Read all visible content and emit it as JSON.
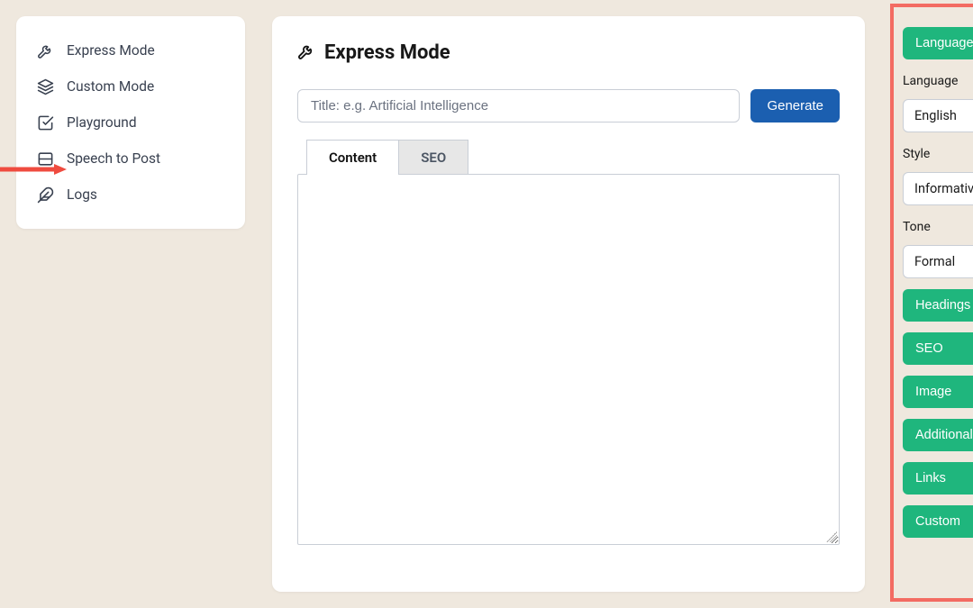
{
  "sidebar": {
    "items": [
      {
        "label": "Express Mode"
      },
      {
        "label": "Custom Mode"
      },
      {
        "label": "Playground"
      },
      {
        "label": "Speech to Post"
      },
      {
        "label": "Logs"
      }
    ]
  },
  "main": {
    "title": "Express Mode",
    "title_placeholder": "Title: e.g. Artificial Intelligence",
    "generate_label": "Generate",
    "tabs": [
      {
        "label": "Content"
      },
      {
        "label": "SEO"
      }
    ]
  },
  "panel": {
    "top_button": "Language",
    "fields": [
      {
        "label": "Language",
        "value": "English"
      },
      {
        "label": "Style",
        "value": "Informative"
      },
      {
        "label": "Tone",
        "value": "Formal"
      }
    ],
    "buttons": [
      "Headings",
      "SEO",
      "Image",
      "Additional",
      "Links",
      "Custom"
    ]
  },
  "colors": {
    "accent_blue": "#1b5fb0",
    "accent_green": "#1fb67d",
    "highlight_red": "#f36b62",
    "bg": "#efe8de"
  }
}
